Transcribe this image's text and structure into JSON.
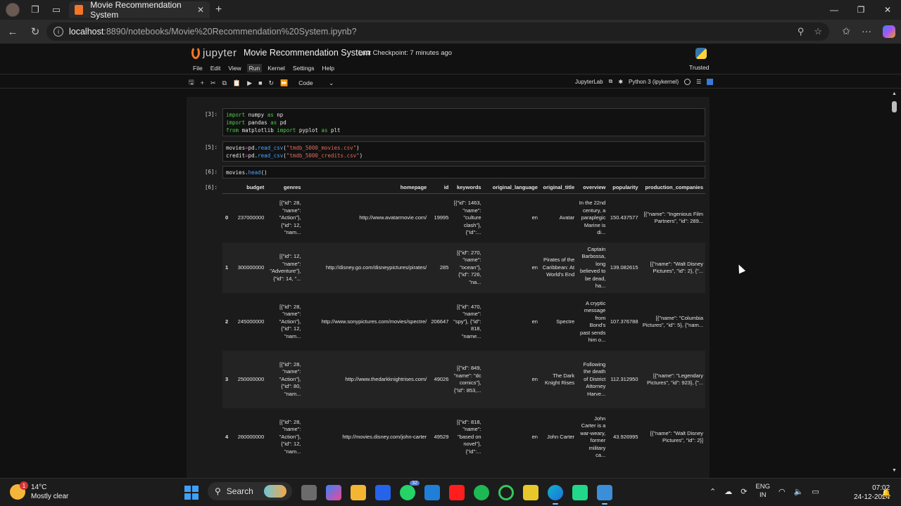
{
  "browser": {
    "tab_title": "Movie Recommendation System",
    "url_host": "localhost",
    "url_path": ":8890/notebooks/Movie%20Recommendation%20System.ipynb?",
    "close_glyph": "✕",
    "new_tab_glyph": "+"
  },
  "jupyter": {
    "logo_text": "jupyter",
    "notebook_title": "Movie Recommendation System",
    "checkpoint": "Last Checkpoint: 7 minutes ago",
    "trusted": "Trusted",
    "menu": [
      "File",
      "Edit",
      "View",
      "Run",
      "Kernel",
      "Settings",
      "Help"
    ],
    "cell_type": "Code",
    "jupyterlab_label": "JupyterLab",
    "kernel": "Python 3 (ipykernel)"
  },
  "cells": [
    {
      "prompt": "[3]:",
      "lines": [
        [
          [
            "kw",
            "import"
          ],
          [
            "t",
            " numpy "
          ],
          [
            "kw",
            "as"
          ],
          [
            "t",
            " np"
          ]
        ],
        [
          [
            "kw",
            "import"
          ],
          [
            "t",
            " pandas "
          ],
          [
            "kw",
            "as"
          ],
          [
            "t",
            " pd"
          ]
        ],
        [
          [
            "kw",
            "from"
          ],
          [
            "t",
            " matplotlib "
          ],
          [
            "kw",
            "import"
          ],
          [
            "t",
            " pyplot "
          ],
          [
            "kw",
            "as"
          ],
          [
            "t",
            " plt"
          ]
        ]
      ]
    },
    {
      "prompt": "[5]:",
      "lines": [
        [
          [
            "t",
            "movies"
          ],
          [
            "op",
            "="
          ],
          [
            "t",
            "pd."
          ],
          [
            "fn",
            "read_csv"
          ],
          [
            "t",
            "("
          ],
          [
            "str",
            "\"tmdb_5000_movies.csv\""
          ],
          [
            "t",
            ")"
          ]
        ],
        [
          [
            "t",
            "credit"
          ],
          [
            "op",
            "="
          ],
          [
            "t",
            "pd."
          ],
          [
            "fn",
            "read_csv"
          ],
          [
            "t",
            "("
          ],
          [
            "str",
            "\"tmdb_5000_credits.csv\""
          ],
          [
            "t",
            ")"
          ]
        ]
      ]
    },
    {
      "prompt": "[6]:",
      "lines": [
        [
          [
            "t",
            "movies."
          ],
          [
            "fn",
            "head"
          ],
          [
            "t",
            "()"
          ]
        ]
      ]
    }
  ],
  "output_prompt": "[6]:",
  "table": {
    "columns": [
      "",
      "budget",
      "genres",
      "homepage",
      "id",
      "keywords",
      "original_language",
      "original_title",
      "overview",
      "popularity",
      "production_companies"
    ],
    "rows": [
      [
        "0",
        "237000000",
        "[{\"id\": 28, \"name\": \"Action\"}, {\"id\": 12, \"nam...",
        "http://www.avatarmovie.com/",
        "19995",
        "[{\"id\": 1463, \"name\": \"culture clash\"}, {\"id\":...",
        "en",
        "Avatar",
        "In the 22nd century, a paraplegic Marine is di...",
        "150.437577",
        "[{\"name\": \"Ingenious Film Partners\", \"id\": 289..."
      ],
      [
        "1",
        "300000000",
        "[{\"id\": 12, \"name\": \"Adventure\"}, {\"id\": 14, \"...",
        "http://disney.go.com/disneypictures/pirates/",
        "285",
        "[{\"id\": 270, \"name\": \"ocean\"}, {\"id\": 726, \"na...",
        "en",
        "Pirates of the Caribbean: At World's End",
        "Captain Barbossa, long believed to be dead, ha...",
        "139.082615",
        "[{\"name\": \"Walt Disney Pictures\", \"id\": 2}, {\"..."
      ],
      [
        "2",
        "245000000",
        "[{\"id\": 28, \"name\": \"Action\"}, {\"id\": 12, \"nam...",
        "http://www.sonypictures.com/movies/spectre/",
        "206647",
        "[{\"id\": 470, \"name\": \"spy\"}, {\"id\": 818, \"name...",
        "en",
        "Spectre",
        "A cryptic message from Bond's past sends him o...",
        "107.376788",
        "[{\"name\": \"Columbia Pictures\", \"id\": 5}, {\"nam..."
      ],
      [
        "3",
        "250000000",
        "[{\"id\": 28, \"name\": \"Action\"}, {\"id\": 80, \"nam...",
        "http://www.thedarkknightrises.com/",
        "49026",
        "[{\"id\": 849, \"name\": \"dc comics\"}, {\"id\": 853,...",
        "en",
        "The Dark Knight Rises",
        "Following the death of District Attorney Harve...",
        "112.312950",
        "[{\"name\": \"Legendary Pictures\", \"id\": 923}, {\"..."
      ],
      [
        "4",
        "260000000",
        "[{\"id\": 28, \"name\": \"Action\"}, {\"id\": 12, \"nam...",
        "http://movies.disney.com/john-carter",
        "49529",
        "[{\"id\": 818, \"name\": \"based on novel\"}, {\"id\":...",
        "en",
        "John Carter",
        "John Carter is a war-weary, former military ca...",
        "43.926995",
        "[{\"name\": \"Walt Disney Pictures\", \"id\": 2}]"
      ]
    ]
  },
  "taskbar": {
    "temp": "14°C",
    "condition": "Mostly clear",
    "weather_badge": "1",
    "search": "Search",
    "whatsapp_badge": "32",
    "lang_line1": "ENG",
    "lang_line2": "IN",
    "time": "07:02",
    "date": "24-12-2024"
  }
}
